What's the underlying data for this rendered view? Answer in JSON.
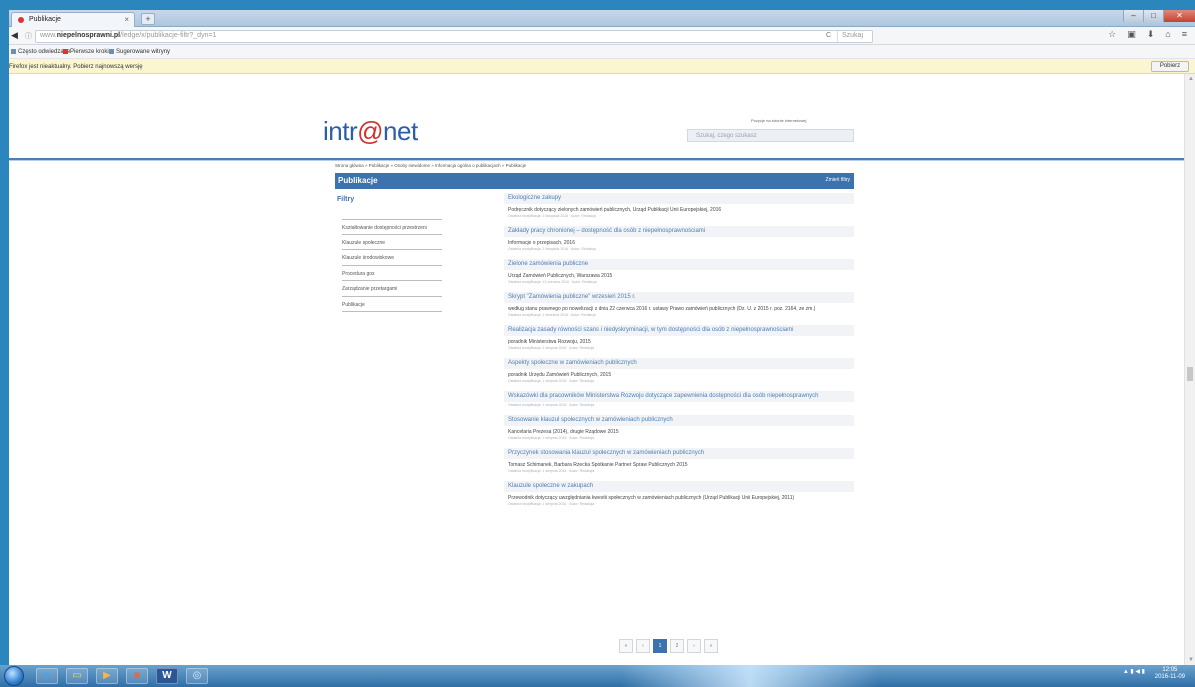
{
  "browser": {
    "tab_title": "Publikacje",
    "tab_close": "×",
    "tab_new": "+",
    "win_minimize": "–",
    "win_maximize": "□",
    "win_close": "✕",
    "url_prefix": "www.",
    "url_domain": "niepelnosprawni.pl",
    "url_path": "/ledge/x/publikacje-filtr?_dyn=1",
    "url_reload": "C",
    "search_placeholder": "Szukaj",
    "nav_back": "◀",
    "nav_info": "ⓘ",
    "icons": [
      "☆",
      "▣",
      "⬇",
      "⌂",
      "≡"
    ]
  },
  "bookmarks": [
    {
      "label": "Często odwiedzane",
      "color": "#6b8fb5"
    },
    {
      "label": "Pierwsze kroki",
      "color": "#d63a2f"
    },
    {
      "label": "Sugerowane witryny",
      "color": "#6b8fb5"
    }
  ],
  "notification": {
    "text": "Firefox jest nieaktualny. Pobierz najnowszą wersję",
    "button": "Pobierz"
  },
  "site": {
    "logo_pre": "intr",
    "logo_at": "@",
    "logo_post": "net",
    "top_link": "Pozycje na stronie internetowej",
    "search_placeholder": "Szukaj, czego szukasz",
    "breadcrumb": "Strona główna » Publikacje » Osoby niewidome » Informacja ogólna o publikacjach » Publikacje",
    "page_title": "Publikacje",
    "title_link": "Zmień filtry",
    "filters_heading": "Filtry",
    "filters": [
      "Kształtowanie dostępności przestrzeni",
      "Klauzule społeczne",
      "Klauzule środowiskowe",
      "Procedura gos",
      "Zarządzanie przetargami",
      "Publikacje"
    ],
    "results": [
      {
        "title": "Ekologiczne zakupy",
        "desc": "Podręcznik dotyczący zielonych zamówień publicznych, Urząd Publikacji Unii Europejskiej, 2016",
        "meta": "Ostatnia modyfikacja: 2 listopada 2016 · Autor: Redakcja"
      },
      {
        "title": "Zakłady pracy chronionej – dostępność dla osób z niepełnosprawnościami",
        "desc": "Informacje o przepisach, 2016",
        "meta": "Ostatnia modyfikacja: 2 listopada 2016 · Autor: Redakcja"
      },
      {
        "title": "Zielone zamówienia publiczne",
        "desc": "Urząd Zamówień Publicznych, Warszawa 2015",
        "meta": "Ostatnia modyfikacja: 12 czerwca 2016 · Autor: Redakcja"
      },
      {
        "title": "Skrypt \"Zamówienia publiczne\" wrzesień 2015 r.",
        "desc": "według stanu prawnego po nowelizacji z dnia 22 czerwca 2016 r. ustawy Prawo zamówień publicznych (Dz. U. z 2015 r. poz. 2164, ze zm.)",
        "meta": "Ostatnia modyfikacja: 1 września 2016 · Autor: Redakcja"
      },
      {
        "title": "Realizacja zasady równości szans i niedyskryminacji, w tym dostępności dla osób z niepełnosprawnościami",
        "desc": "poradnik Ministerstwa Rozwoju, 2015",
        "meta": "Ostatnia modyfikacja: 2 sierpnia 2016 · Autor: Redakcja"
      },
      {
        "title": "Aspekty społeczne w zamówieniach publicznych",
        "desc": "poradnik Urzędu Zamówień Publicznych, 2015",
        "meta": "Ostatnia modyfikacja: 1 sierpnia 2016 · Autor: Redakcja"
      },
      {
        "title": "Wskazówki dla pracowników Ministerstwa Rozwoju dotyczące zapewnienia dostępności dla osób niepełnosprawnych",
        "desc": "",
        "meta": "Ostatnia modyfikacja: 1 sierpnia 2016 · Autor: Redakcja"
      },
      {
        "title": "Stosowanie klauzul społecznych w zamówieniach publicznych",
        "desc": "Kancelaria Prezesa (2014), drugie Rządowe 2015",
        "meta": "Ostatnia modyfikacja: 1 sierpnia 2016 · Autor: Redakcja"
      },
      {
        "title": "Przyczynek stosowania klauzul społecznych w zamówieniach publicznych",
        "desc": "Tomasz Schimanek, Barbara Rzecka Spotkanie Partner Spraw Publicznych 2015",
        "meta": "Ostatnia modyfikacja: 1 sierpnia 2016 · Autor: Redakcja"
      },
      {
        "title": "Klauzule społeczne w zakupach",
        "desc": "Przewodnik dotyczący uwzględniania kwestii społecznych w zamówieniach publicznych (Urząd Publikacji Unii Europejskiej, 2011)",
        "meta": "Ostatnia modyfikacja: 1 sierpnia 2016 · Autor: Redakcja"
      }
    ],
    "pager": [
      "«",
      "‹",
      "1",
      "2",
      "›",
      "»"
    ],
    "pager_active_index": 2
  },
  "taskbar": {
    "apps": [
      "e",
      "▭",
      "▶",
      "■",
      "W",
      "◎"
    ],
    "tray": "▲ ▮ ◀ ▮",
    "time": "12:05",
    "date": "2016-11-09"
  },
  "colors": {
    "accent": "#3d73ad",
    "logo": "#2a5fa8",
    "logo_at": "#d0312d",
    "notification": "#fbf6cf"
  }
}
